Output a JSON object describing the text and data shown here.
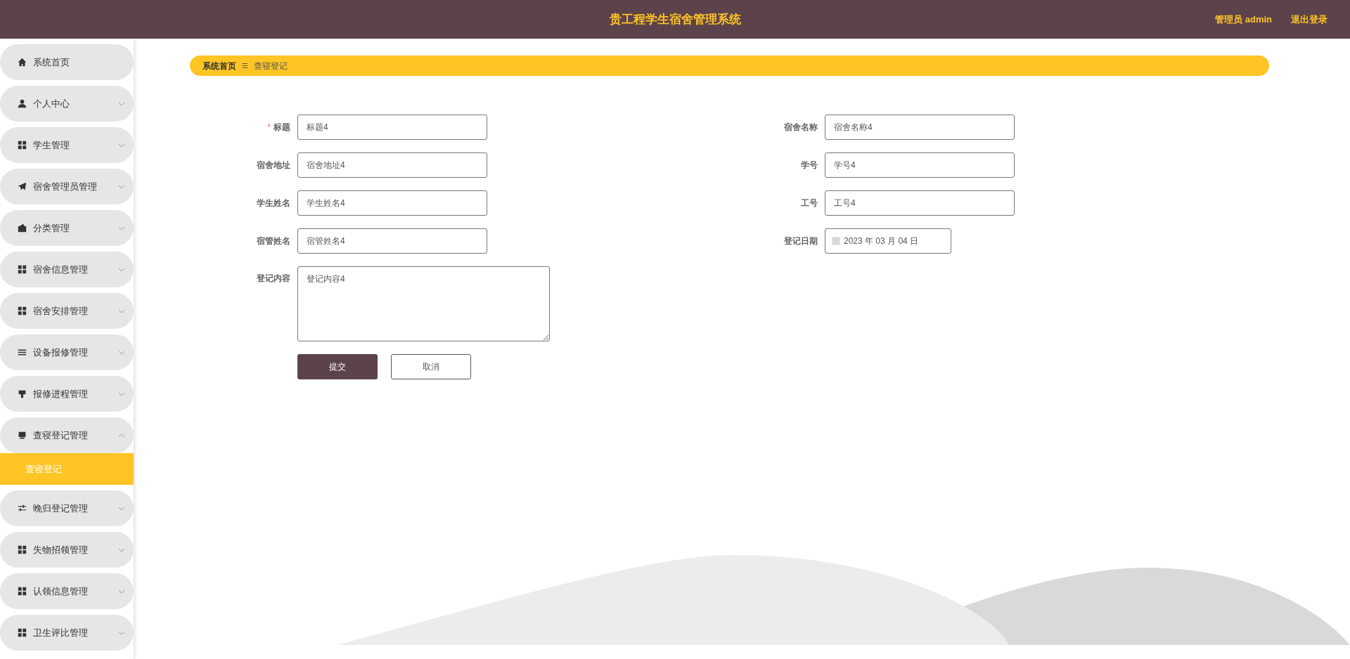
{
  "header": {
    "title": "贵工程学生宿舍管理系统",
    "user": "管理员 admin",
    "logout": "退出登录"
  },
  "sidebar": {
    "items": [
      {
        "label": "系统首页"
      },
      {
        "label": "个人中心",
        "expanded": false
      },
      {
        "label": "学生管理",
        "expanded": false
      },
      {
        "label": "宿舍管理员管理",
        "expanded": false
      },
      {
        "label": "分类管理",
        "expanded": false
      },
      {
        "label": "宿舍信息管理",
        "expanded": false
      },
      {
        "label": "宿舍安排管理",
        "expanded": false
      },
      {
        "label": "设备报修管理",
        "expanded": false
      },
      {
        "label": "报修进程管理",
        "expanded": false
      },
      {
        "label": "查寝登记管理",
        "expanded": true,
        "children": [
          {
            "label": "查寝登记",
            "selected": true
          }
        ]
      },
      {
        "label": "晚归登记管理",
        "expanded": false
      },
      {
        "label": "失物招领管理",
        "expanded": false
      },
      {
        "label": "认领信息管理",
        "expanded": false
      },
      {
        "label": "卫生评比管理",
        "expanded": false
      }
    ]
  },
  "breadcrumb": {
    "home": "系统首页",
    "separator": "☰",
    "current": "查寝登记"
  },
  "form": {
    "left": [
      {
        "label": "标题",
        "required_mark": "*",
        "value": "标题4"
      },
      {
        "label": "宿舍地址",
        "value": "宿舍地址4"
      },
      {
        "label": "学生姓名",
        "value": "学生姓名4"
      },
      {
        "label": "宿管姓名",
        "value": "宿管姓名4"
      }
    ],
    "right": [
      {
        "label": "宿舍名称",
        "kind": "text",
        "value": "宿舍名称4"
      },
      {
        "label": "学号",
        "kind": "text",
        "value": "学号4"
      },
      {
        "label": "工号",
        "kind": "text",
        "value": "工号4"
      },
      {
        "label": "登记日期",
        "kind": "date",
        "value": "2023 年 03 月 04 日"
      }
    ],
    "content": {
      "label": "登记内容",
      "value": "登记内容4"
    },
    "submit": "提交",
    "cancel": "取消"
  }
}
